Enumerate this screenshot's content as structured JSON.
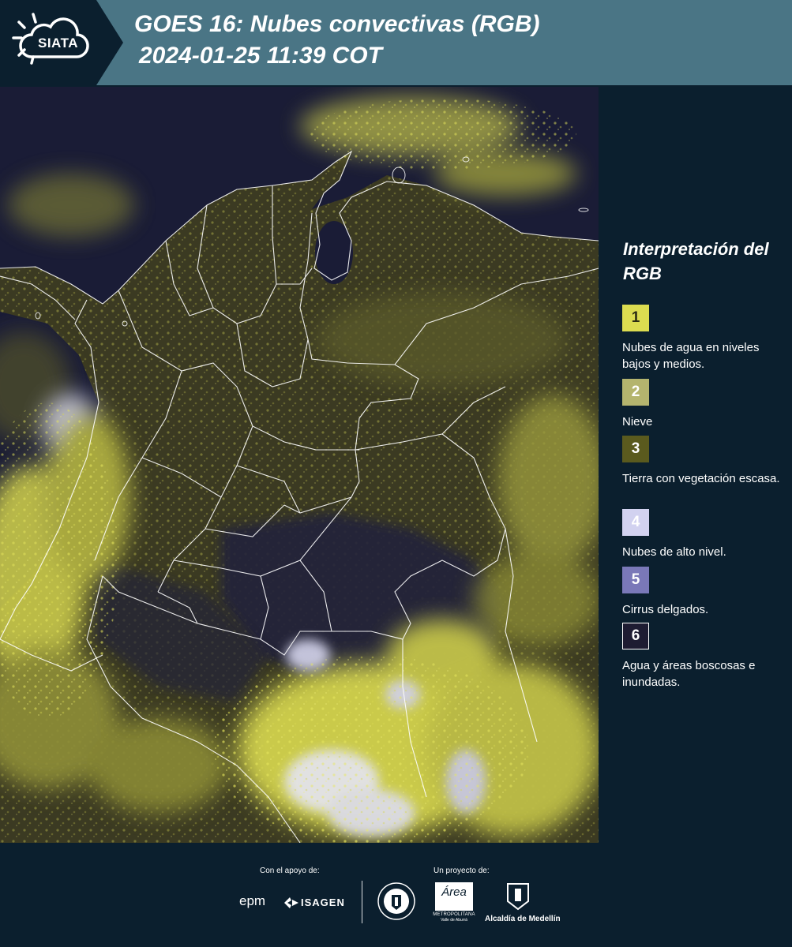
{
  "header": {
    "logo_text": "SIATA",
    "title_line1": "GOES 16: Nubes convectivas (RGB)",
    "title_line2": "2024-01-25 11:39 COT"
  },
  "legend": {
    "title": "Interpretación del RGB",
    "items": [
      {
        "number": "1",
        "label": "Nubes de agua en niveles bajos y medios.",
        "color": "#dcdc50",
        "text_color": "#2b2b14"
      },
      {
        "number": "2",
        "label": "Nieve",
        "color": "#b4b46e",
        "text_color": "#ffffff"
      },
      {
        "number": "3",
        "label": "Tierra con vegetación escasa.",
        "color": "#5a5a1e",
        "text_color": "#ffffff"
      },
      {
        "number": "4",
        "label": "Nubes de alto nivel.",
        "color": "#d2d2f0",
        "text_color": "#ffffff"
      },
      {
        "number": "5",
        "label": "Cirrus delgados.",
        "color": "#7a78b8",
        "text_color": "#ffffff"
      },
      {
        "number": "6",
        "label": "Agua y áreas boscosas e inundadas.",
        "color": "#1e1c32",
        "text_color": "#ffffff"
      }
    ]
  },
  "footer": {
    "support_label": "Con el apoyo de:",
    "project_label": "Un proyecto de:",
    "sponsor_epm": "epm",
    "sponsor_isagen": "ISAGEN",
    "sponsor_area": "Área",
    "sponsor_area_sub": "METROPOLITANA",
    "sponsor_area_sub2": "Valle de Aburrá",
    "sponsor_alcaldia": "Alcaldía de Medellín"
  },
  "colors": {
    "header_bg": "#4a7585",
    "panel_bg": "#0b1f2e",
    "ocean": "#1a1c36",
    "land": "#3d3c22",
    "cloud_yellow": "#e2e25a"
  }
}
